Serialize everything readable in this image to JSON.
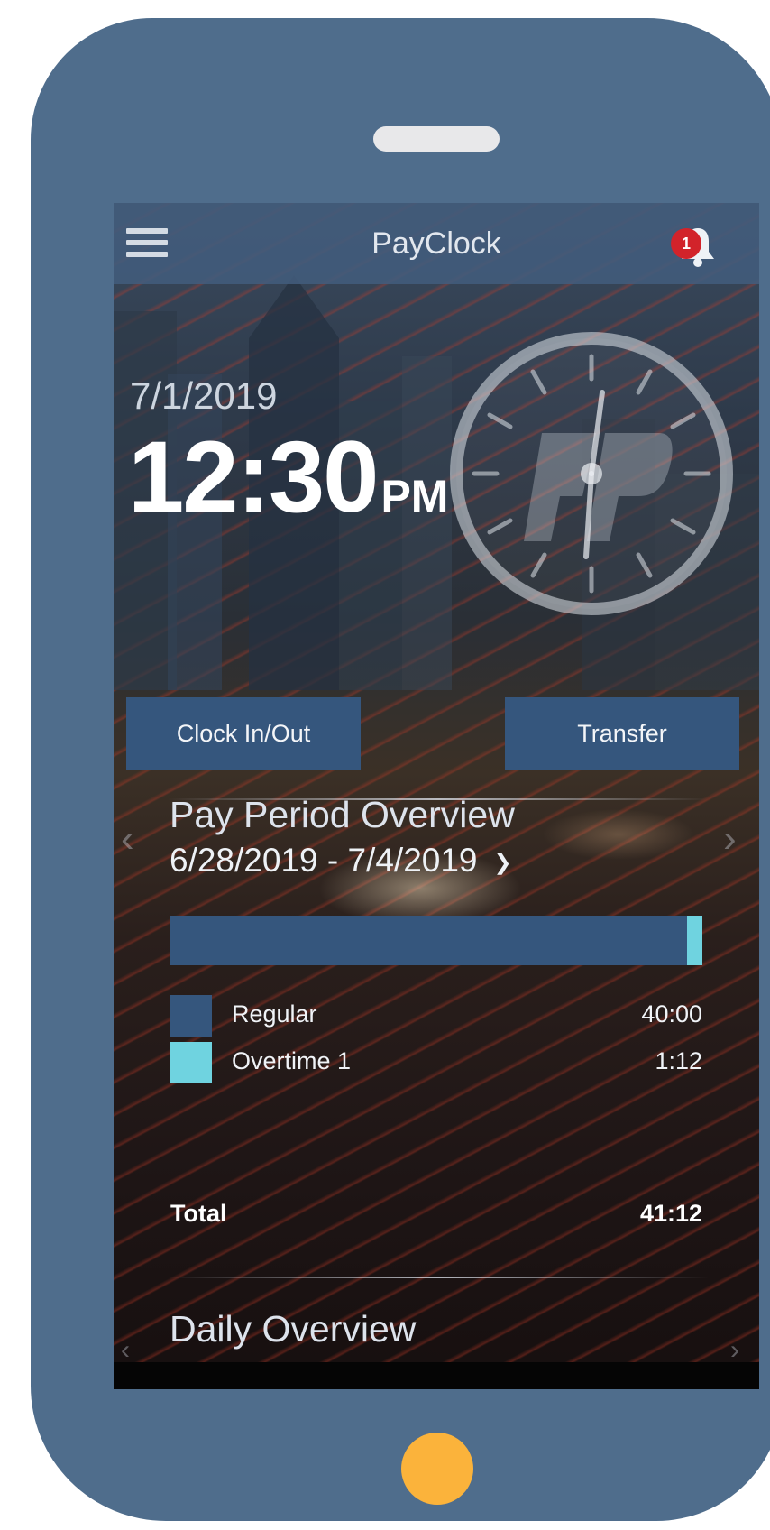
{
  "app": {
    "title": "PayClock",
    "notifications_count": "1"
  },
  "current": {
    "date": "7/1/2019",
    "time": "12:30",
    "ampm": "PM"
  },
  "actions": {
    "clock_in_out": "Clock In/Out",
    "transfer": "Transfer"
  },
  "pay_period": {
    "title": "Pay Period Overview",
    "range": "6/28/2019 - 7/4/2019",
    "regular_fraction": 0.971,
    "overtime_fraction": 0.029,
    "legend": [
      {
        "label": "Regular",
        "value": "40:00",
        "color": "#35567d"
      },
      {
        "label": "Overtime 1",
        "value": "1:12",
        "color": "#6fd3e0"
      }
    ],
    "total_label": "Total",
    "total_value": "41:12"
  },
  "daily": {
    "title": "Daily Overview"
  },
  "icons": [
    "menu-icon",
    "bell-icon",
    "chevron-down-icon",
    "chevron-left-icon",
    "chevron-right-icon",
    "clock-logo-icon"
  ],
  "colors": {
    "phone_frame": "#4f6d8c",
    "home_button": "#fbb33b",
    "badge": "#d2232a",
    "button": "#35567d",
    "overtime": "#6fd3e0"
  }
}
